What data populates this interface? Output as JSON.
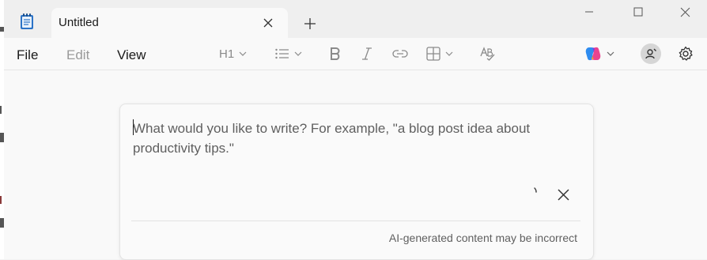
{
  "window": {
    "tab_title": "Untitled"
  },
  "menu": {
    "file": "File",
    "edit": "Edit",
    "view": "View"
  },
  "toolbar": {
    "heading_label": "H1",
    "heading_icon": "heading-icon",
    "list_icon": "bulleted-list-icon",
    "bold_icon": "bold-icon",
    "italic_icon": "italic-icon",
    "link_icon": "link-icon",
    "table_icon": "table-icon",
    "spellcheck_icon": "spellcheck-icon",
    "copilot_icon": "copilot-icon",
    "avatar_icon": "account-icon",
    "settings_icon": "gear-icon"
  },
  "prompt": {
    "placeholder": "What would you like to write? For example, \"a blog post idea about productivity tips.\"",
    "disclaimer": "AI-generated content may be incorrect"
  },
  "colors": {
    "titlebar": "#efefef",
    "surface": "#f9f9f9",
    "disabled_text": "#9a9a9a",
    "placeholder_text": "#5f5f5f"
  }
}
